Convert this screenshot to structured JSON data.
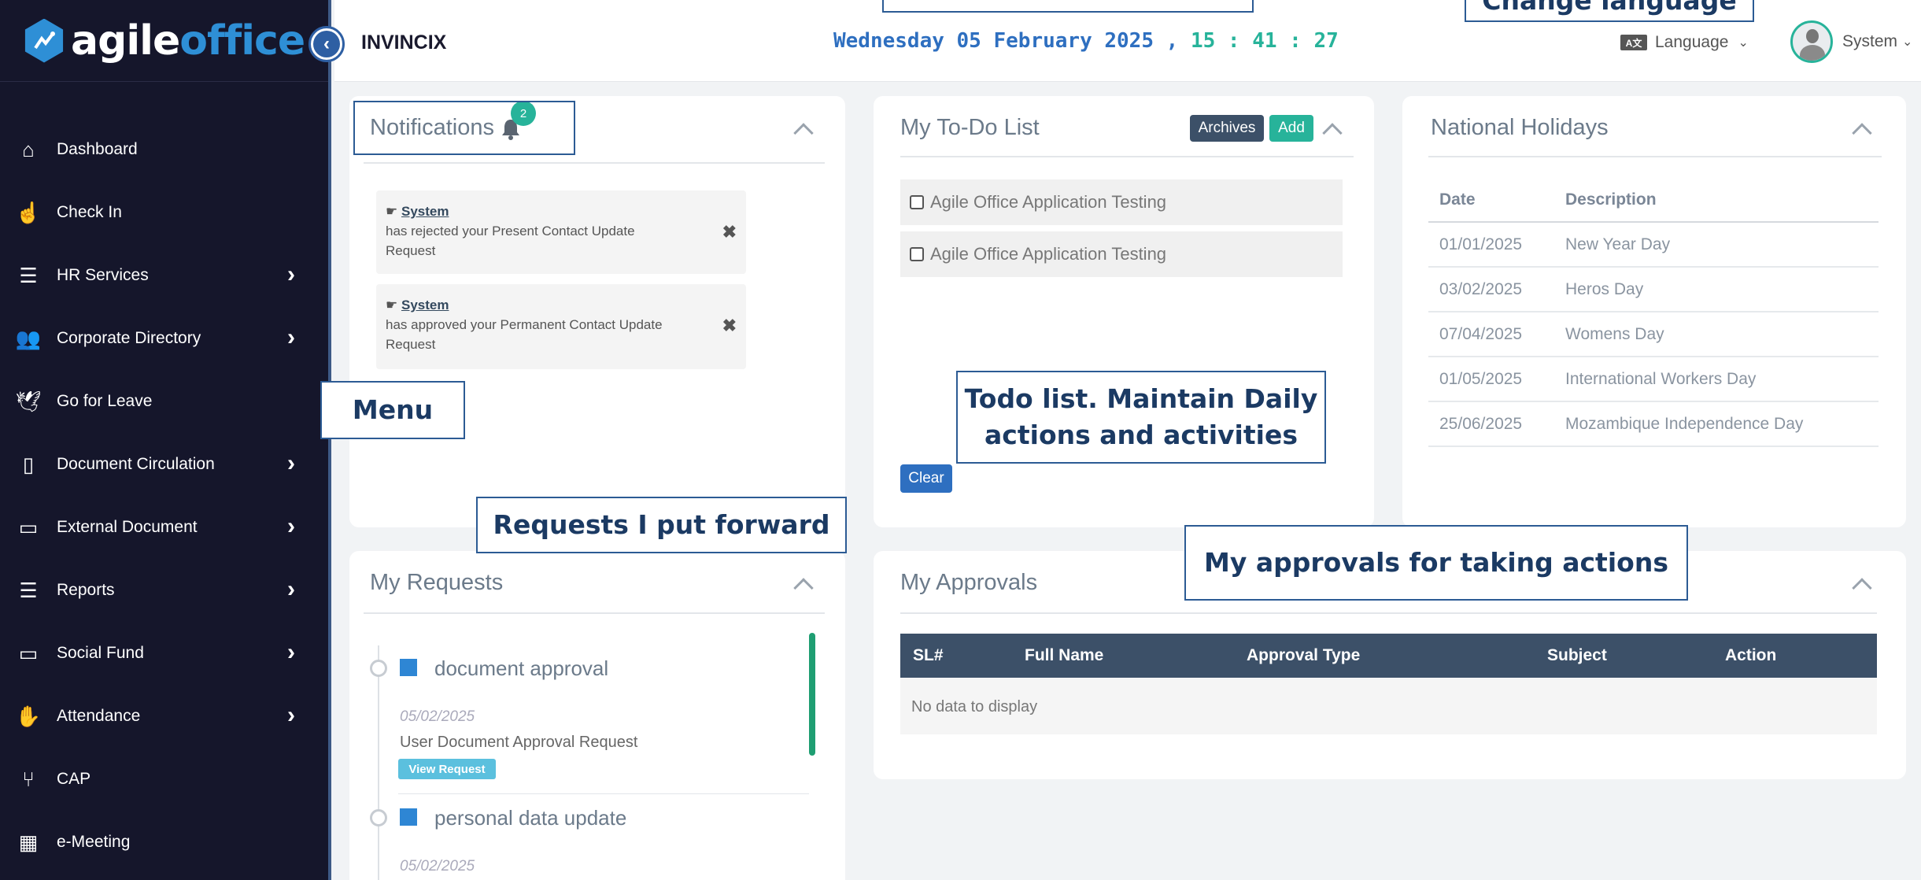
{
  "brand": {
    "name_part1": "agile",
    "name_part2": "office"
  },
  "sidebar": {
    "items": [
      {
        "label": "Dashboard",
        "icon": "home-icon",
        "has_children": false
      },
      {
        "label": "Check In",
        "icon": "hand-pointer-icon",
        "has_children": false
      },
      {
        "label": "HR Services",
        "icon": "list-check-icon",
        "has_children": true
      },
      {
        "label": "Corporate Directory",
        "icon": "users-icon",
        "has_children": true
      },
      {
        "label": "Go for Leave",
        "icon": "bird-icon",
        "has_children": false
      },
      {
        "label": "Document Circulation",
        "icon": "document-icon",
        "has_children": true
      },
      {
        "label": "External Document",
        "icon": "folder-open-icon",
        "has_children": true
      },
      {
        "label": "Reports",
        "icon": "list-icon",
        "has_children": true
      },
      {
        "label": "Social Fund",
        "icon": "folder-open-icon",
        "has_children": true
      },
      {
        "label": "Attendance",
        "icon": "hand-icon",
        "has_children": true
      },
      {
        "label": "CAP",
        "icon": "code-branch-icon",
        "has_children": false
      },
      {
        "label": "e-Meeting",
        "icon": "calendar-icon",
        "has_children": false
      }
    ]
  },
  "topbar": {
    "company": "INVINCIX",
    "date": "Wednesday 05 February 2025 ,",
    "time": "15 : 41 : 27",
    "language_label": "Language",
    "language_icon_text": "A文",
    "user_name": "System"
  },
  "notifications": {
    "title": "Notifications",
    "badge_count": "2",
    "items": [
      {
        "sender": "System",
        "message": "has rejected your Present Contact Update Request"
      },
      {
        "sender": "System",
        "message": "has approved your Permanent Contact Update Request"
      }
    ]
  },
  "todo": {
    "title": "My To-Do List",
    "archives_label": "Archives",
    "add_label": "Add",
    "clear_label": "Clear",
    "items": [
      {
        "text": "Agile Office Application Testing",
        "checked": false
      },
      {
        "text": "Agile Office Application Testing",
        "checked": false
      }
    ]
  },
  "holidays": {
    "title": "National Holidays",
    "columns": [
      "Date",
      "Description"
    ],
    "rows": [
      {
        "date": "01/01/2025",
        "description": "New Year Day"
      },
      {
        "date": "03/02/2025",
        "description": "Heros Day"
      },
      {
        "date": "07/04/2025",
        "description": "Womens Day"
      },
      {
        "date": "01/05/2025",
        "description": "International Workers Day"
      },
      {
        "date": "25/06/2025",
        "description": "Mozambique Independence Day"
      }
    ]
  },
  "requests": {
    "title": "My Requests",
    "items": [
      {
        "title": "document approval",
        "date": "05/02/2025",
        "description": "User Document Approval Request",
        "button_label": "View Request"
      },
      {
        "title": "personal data update",
        "date": "05/02/2025"
      }
    ]
  },
  "approvals": {
    "title": "My Approvals",
    "columns": [
      "SL#",
      "Full Name",
      "Approval Type",
      "Subject",
      "Action"
    ],
    "empty_message": "No data to display"
  },
  "annotations": {
    "menu": "Menu",
    "requests": "Requests I put forward",
    "todo_line1": "Todo list. Maintain Daily",
    "todo_line2": "actions and activities",
    "approvals": "My approvals for taking actions",
    "change_language": "Change language"
  },
  "colors": {
    "sidebar_bg": "#15162b",
    "accent_blue": "#2e86d4",
    "accent_green": "#27b39a",
    "table_header": "#3c5068"
  }
}
